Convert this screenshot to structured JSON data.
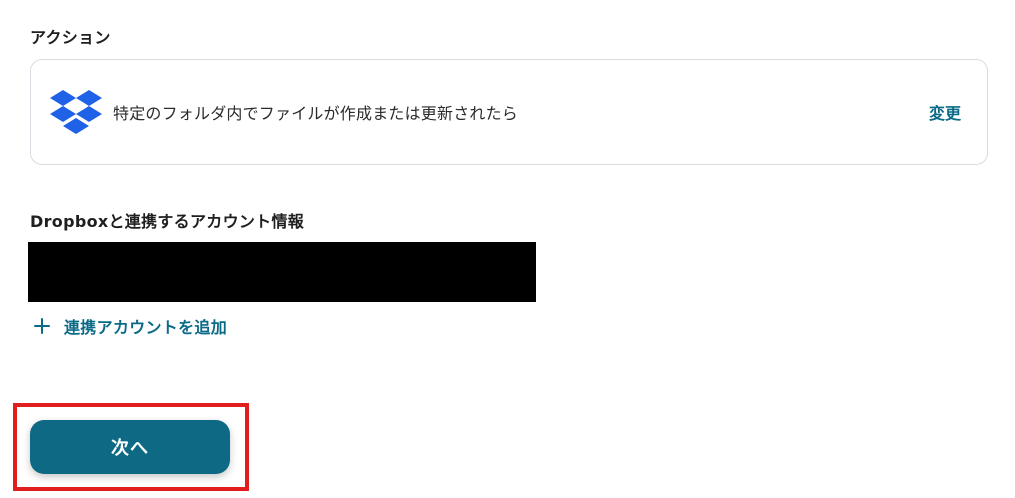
{
  "action": {
    "section_label": "アクション",
    "trigger_text": "特定のフォルダ内でファイルが作成または更新されたら",
    "change_label": "変更",
    "service_icon": "dropbox-icon"
  },
  "account": {
    "section_label": "Dropboxと連携するアカウント情報",
    "add_account_label": "連携アカウントを追加"
  },
  "footer": {
    "next_label": "次へ"
  },
  "colors": {
    "accent": "#0b6a86",
    "button": "#0e6a84",
    "highlight": "#e01e1e",
    "dropbox": "#1f62e8"
  }
}
